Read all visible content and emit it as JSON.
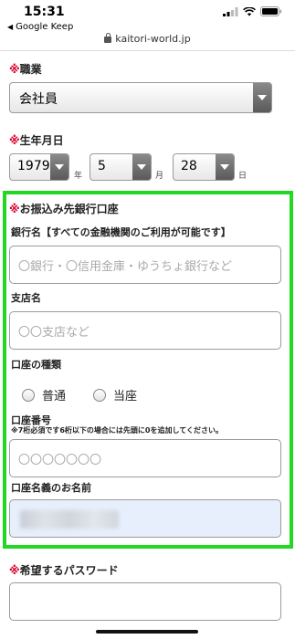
{
  "status_bar": {
    "time": "15:31"
  },
  "back_app": {
    "label": "Google Keep"
  },
  "url_bar": {
    "domain": "kaitori-world.jp"
  },
  "required_mark": "※",
  "occupation": {
    "label": "職業",
    "selected": "会社員"
  },
  "birthdate": {
    "label": "生年月日",
    "year": "1979",
    "year_unit": "年",
    "month": "5",
    "month_unit": "月",
    "day": "28",
    "day_unit": "日"
  },
  "bank": {
    "section_label": "お振込み先銀行口座",
    "bank_name": {
      "label": "銀行名【すべての金融機関のご利用が可能です】",
      "placeholder": "〇銀行・〇信用金庫・ゆうちょ銀行など"
    },
    "branch": {
      "label": "支店名",
      "placeholder": "〇〇支店など"
    },
    "account_type": {
      "label": "口座の種類",
      "options": [
        "普通",
        "当座"
      ]
    },
    "account_number": {
      "label": "口座番号",
      "note": "※7桁必須です6桁以下の場合には先頭に0を追加してください。",
      "placeholder": "〇〇〇〇〇〇〇"
    },
    "account_holder": {
      "label": "口座名義のお名前"
    }
  },
  "password": {
    "label": "希望するパスワード"
  },
  "colors": {
    "accent_green": "#22d822",
    "required_red": "#d8002a"
  }
}
